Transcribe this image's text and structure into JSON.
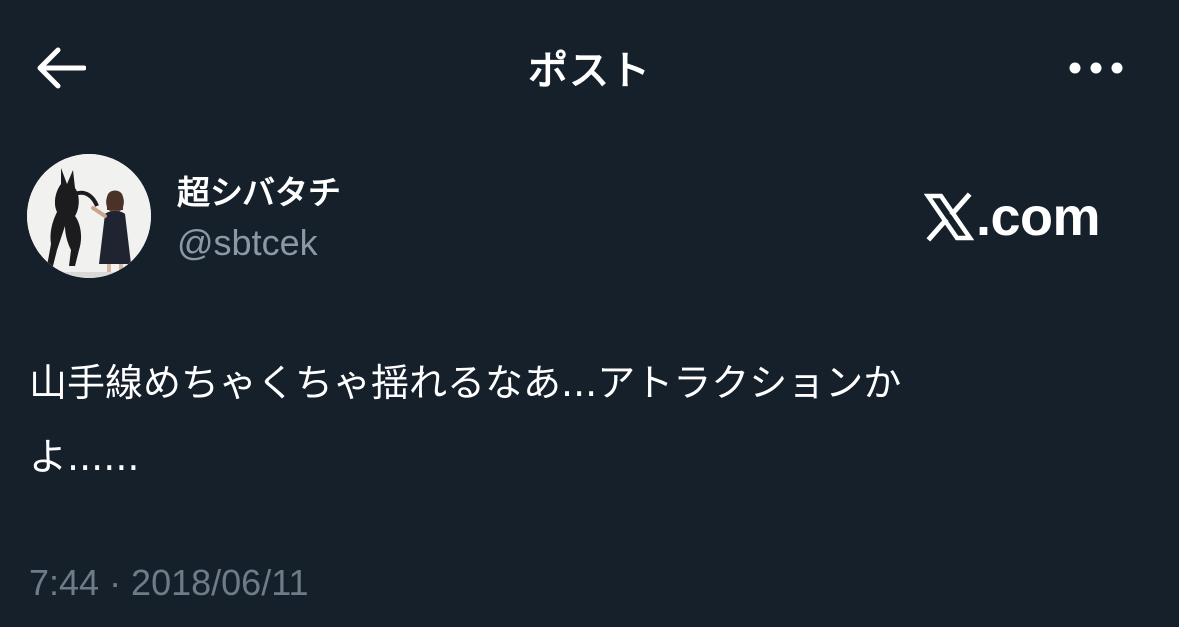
{
  "header": {
    "title": "ポスト",
    "back_icon": "arrow-left-icon",
    "more_icon": "more-horizontal-icon"
  },
  "author": {
    "display_name": "超シバタチ",
    "handle": "@sbtcek",
    "avatar_alt": "avatar"
  },
  "watermark": {
    "text": ".com",
    "logo_icon": "x-logo-icon"
  },
  "tweet": {
    "line1": "山手線めちゃくちゃ揺れるなあ...アトラクションか",
    "line2": "よ......"
  },
  "meta": {
    "timestamp": "7:44 · 2018/06/11"
  },
  "colors": {
    "background": "#15202b",
    "primary_text": "#ffffff",
    "secondary_text": "#8b98a5",
    "timestamp_text": "#6e7b88"
  }
}
